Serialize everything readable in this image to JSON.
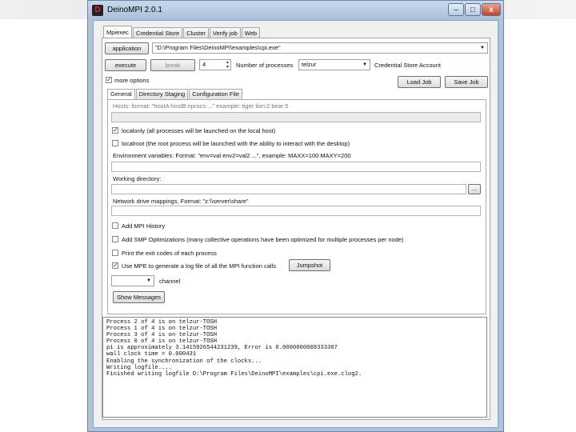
{
  "window": {
    "title": "DeinoMPI 2.0.1",
    "minimize": "–",
    "maximize": "□",
    "close": "x"
  },
  "tabs": [
    "Mpiexec",
    "Credential Store",
    "Cluster",
    "Verify job",
    "Web"
  ],
  "application": {
    "button": "application",
    "value": "\"D:\\Program Files\\DeinoMPI\\examples\\cpi.exe\""
  },
  "run": {
    "execute": "execute",
    "break": "break",
    "processes": "4",
    "processes_label": "Number of processes",
    "account": "telzur",
    "account_label": "Credential Store Account"
  },
  "options": {
    "more_options": "more options",
    "load_job": "Load Job",
    "save_job": "Save Job"
  },
  "subtabs": [
    "General",
    "Directory Staging",
    "Configuration File"
  ],
  "general": {
    "hosts_label": "Hosts: format: \"hostA hostB:nprocs ...\" example: tiger lion:2 bear:5",
    "localonly": "localonly (all processes will be launched on the local host)",
    "localroot": "localroot (the root process will be launched with the ability to interact with the desktop)",
    "env_label": "Environment variables: Format: \"env=val env2=val2 ...\", example: MAXX=100 MAXY=200",
    "workdir_label": "Working directory:",
    "browse": "...",
    "network_label": "Network drive mappings, Format: \"z:\\\\server\\share\"",
    "mpi_history": "Add MPI History",
    "smp": "Add SMP Optimizations (many collective operations have been optimized for multiple processes per node)",
    "exit_codes": "Print the exit codes of each process",
    "mpe": "Use MPE to generate a log file of all the MPI function calls",
    "jumpshot": "Jumpshot",
    "channel_label": "channel",
    "show_messages": "Show Messages"
  },
  "console": [
    "Process 2 of 4 is on telzur-TOSH",
    "Process 1 of 4 is on telzur-TOSH",
    "Process 3 of 4 is on telzur-TOSH",
    "Process 0 of 4 is on telzur-TOSH",
    "pi is approximately 3.1415926544231239, Error is 0.0000000008333307",
    "wall clock time = 0.000431",
    "Enabling the synchronization of the clocks...",
    "Writing logfile....",
    "Finished writing logfile D:\\Program Files\\DeinoMPI\\examples\\cpi.exe.clog2."
  ],
  "colors": {
    "frame": "#aec4dc",
    "close": "#c3412b",
    "panel": "#f0f0f0"
  }
}
